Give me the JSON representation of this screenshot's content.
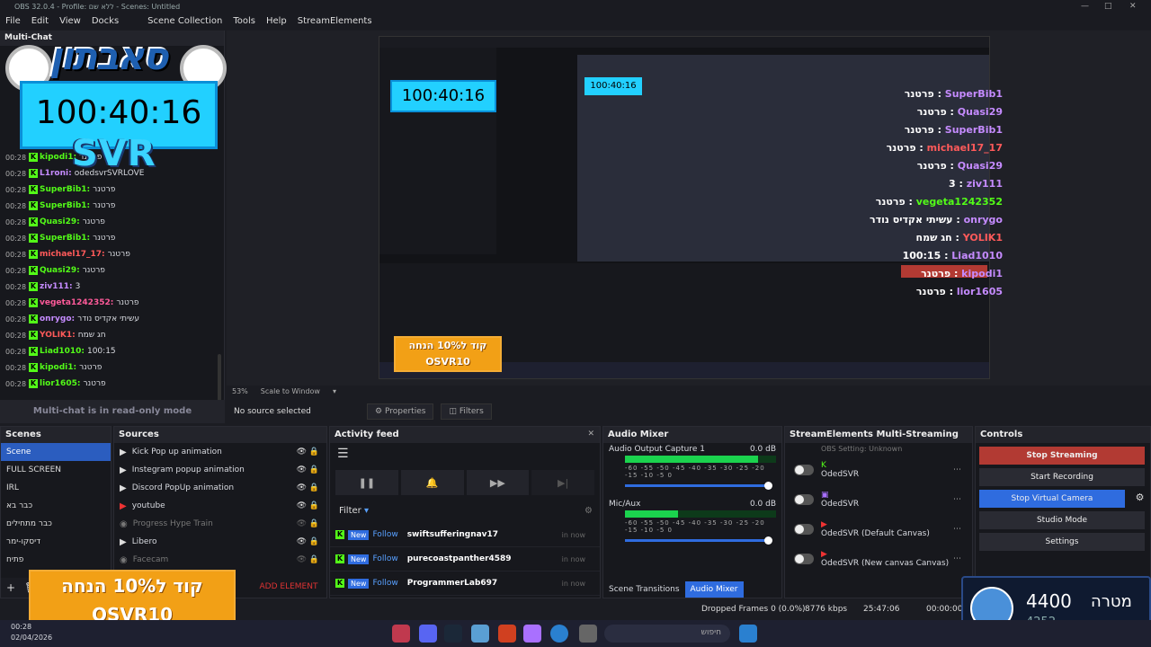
{
  "window": {
    "title": "OBS 32.0.4 - Profile: ללא שם - Scenes: Untitled"
  },
  "menu": [
    "File",
    "Edit",
    "View",
    "Docks",
    "Scene Collection",
    "Tools",
    "Help",
    "StreamElements"
  ],
  "multichat": {
    "title": "Multi-Chat",
    "readonly": "Multi-chat is in read-only mode",
    "messages": [
      {
        "time": "00:28",
        "user": "kipodi1:",
        "text": "פרטנר",
        "color": "#53fc18"
      },
      {
        "time": "00:28",
        "user": "L1roni:",
        "text": "odedsvrSVRLOVE",
        "color": "#c58bff"
      },
      {
        "time": "00:28",
        "user": "SuperBib1:",
        "text": "פרטנר",
        "color": "#53fc18"
      },
      {
        "time": "00:28",
        "user": "SuperBib1:",
        "text": "פרטנר",
        "color": "#53fc18"
      },
      {
        "time": "00:28",
        "user": "Quasi29:",
        "text": "פרטנר",
        "color": "#53fc18"
      },
      {
        "time": "00:28",
        "user": "SuperBib1:",
        "text": "פרטנר",
        "color": "#53fc18"
      },
      {
        "time": "00:28",
        "user": "michael17_17:",
        "text": "פרטנר",
        "color": "#ff5a5a"
      },
      {
        "time": "00:28",
        "user": "Quasi29:",
        "text": "פרטנר",
        "color": "#53fc18"
      },
      {
        "time": "00:28",
        "user": "ziv111:",
        "text": "3",
        "color": "#c58bff"
      },
      {
        "time": "00:28",
        "user": "vegeta1242352:",
        "text": "פרטנר",
        "color": "#ff5a9a"
      },
      {
        "time": "00:28",
        "user": "onrygo:",
        "text": "עשיתי אקדיס נודר",
        "color": "#c58bff"
      },
      {
        "time": "00:28",
        "user": "YOLIK1:",
        "text": "חג שמח",
        "color": "#ff5a5a"
      },
      {
        "time": "00:28",
        "user": "Liad1010:",
        "text": "100:15",
        "color": "#53fc18"
      },
      {
        "time": "00:28",
        "user": "kipodi1:",
        "text": "פרטנר",
        "color": "#53fc18"
      },
      {
        "time": "00:28",
        "user": "lior1605:",
        "text": "פרטנר",
        "color": "#53fc18"
      }
    ]
  },
  "overlay": {
    "logo": "סאבתון",
    "timer": "100:40:16",
    "brand": "SVR",
    "promo_line1": "קוד ל10% הנחה",
    "promo_line2": "OSVR10",
    "goal_value": "4400",
    "goal_label": "מטרה",
    "goal_current": "4252"
  },
  "overlay_chat": [
    {
      "user": "SuperBib1",
      "text": "פרטנר"
    },
    {
      "user": "Quasi29",
      "text": "פרטנר"
    },
    {
      "user": "SuperBib1",
      "text": "פרטנר"
    },
    {
      "user": "michael17_17",
      "text": "פרטנר"
    },
    {
      "user": "Quasi29",
      "text": "פרטנר"
    },
    {
      "user": "ziv111",
      "text": "3"
    },
    {
      "user": "vegeta1242352",
      "text": "פרטנר"
    },
    {
      "user": "onrygo",
      "text": "עשיתי אקדיס נודר"
    },
    {
      "user": "YOLIK1",
      "text": "חג שמח"
    },
    {
      "user": "Liad1010",
      "text": "100:15"
    },
    {
      "user": "kipodi1",
      "text": "פרטנר"
    },
    {
      "user": "lior1605",
      "text": "פרטנר"
    }
  ],
  "preview": {
    "zoom": "53%",
    "scale_mode": "Scale to Window"
  },
  "source_bar": {
    "no_source": "No source selected",
    "properties": "Properties",
    "filters": "Filters"
  },
  "scenes": {
    "title": "Scenes",
    "items": [
      "Scene",
      "FULL SCREEN",
      "IRL",
      "כבר בא",
      "כבר מתחילים",
      "דיסקו-ימר",
      "פתיח"
    ]
  },
  "sources": {
    "title": "Sources",
    "add_element": "ADD ELEMENT",
    "items": [
      {
        "name": "Kick Pop up animation",
        "dim": false
      },
      {
        "name": "Instegram popup animation",
        "dim": false
      },
      {
        "name": "Discord PopUp animation",
        "dim": false
      },
      {
        "name": "youtube",
        "dim": false
      },
      {
        "name": "Progress Hype Train",
        "dim": true
      },
      {
        "name": "Libero",
        "dim": false
      },
      {
        "name": "Facecam",
        "dim": true
      }
    ]
  },
  "activity": {
    "title": "Activity feed",
    "filter": "Filter",
    "items": [
      {
        "badge": "New",
        "type": "Follow",
        "name": "swiftsufferingnav17",
        "ago": "in now"
      },
      {
        "badge": "New",
        "type": "Follow",
        "name": "purecoastpanther4589",
        "ago": "in now"
      },
      {
        "badge": "New",
        "type": "Follow",
        "name": "ProgrammerLab697",
        "ago": "in now"
      }
    ]
  },
  "mixer": {
    "title": "Audio Mixer",
    "channels": [
      {
        "name": "Audio Output Capture 1",
        "db": "0.0 dB",
        "level": 0.88
      },
      {
        "name": "Mic/Aux",
        "db": "0.0 dB",
        "level": 0.35
      }
    ],
    "ticks": "-60 -55 -50 -45 -40 -35 -30 -25 -20 -15 -10 -5 0",
    "tab_transitions": "Scene Transitions",
    "tab_mixer": "Audio Mixer"
  },
  "multistream": {
    "title": "StreamElements Multi-Streaming",
    "status": "OBS Setting: Unknown",
    "items": [
      {
        "name": "OdedSVR",
        "platform": "kick"
      },
      {
        "name": "OdedSVR",
        "platform": "twitch"
      },
      {
        "name": "OdedSVR (Default Canvas)",
        "platform": "youtube"
      },
      {
        "name": "OdedSVR (New canvas Canvas)",
        "platform": "youtube"
      }
    ]
  },
  "controls": {
    "title": "Controls",
    "buttons": [
      "Stop Streaming",
      "Start Recording",
      "Stop Virtual Camera",
      "Studio Mode",
      "Settings"
    ]
  },
  "status": {
    "dropped": "Dropped Frames 0 (0.0%)",
    "kbps": "8776 kbps",
    "stream_time": "25:47:06",
    "rec_time": "00:00:00"
  },
  "taskbar": {
    "search": "חיפוש",
    "time": "00:28",
    "date": "02/04/2026"
  }
}
